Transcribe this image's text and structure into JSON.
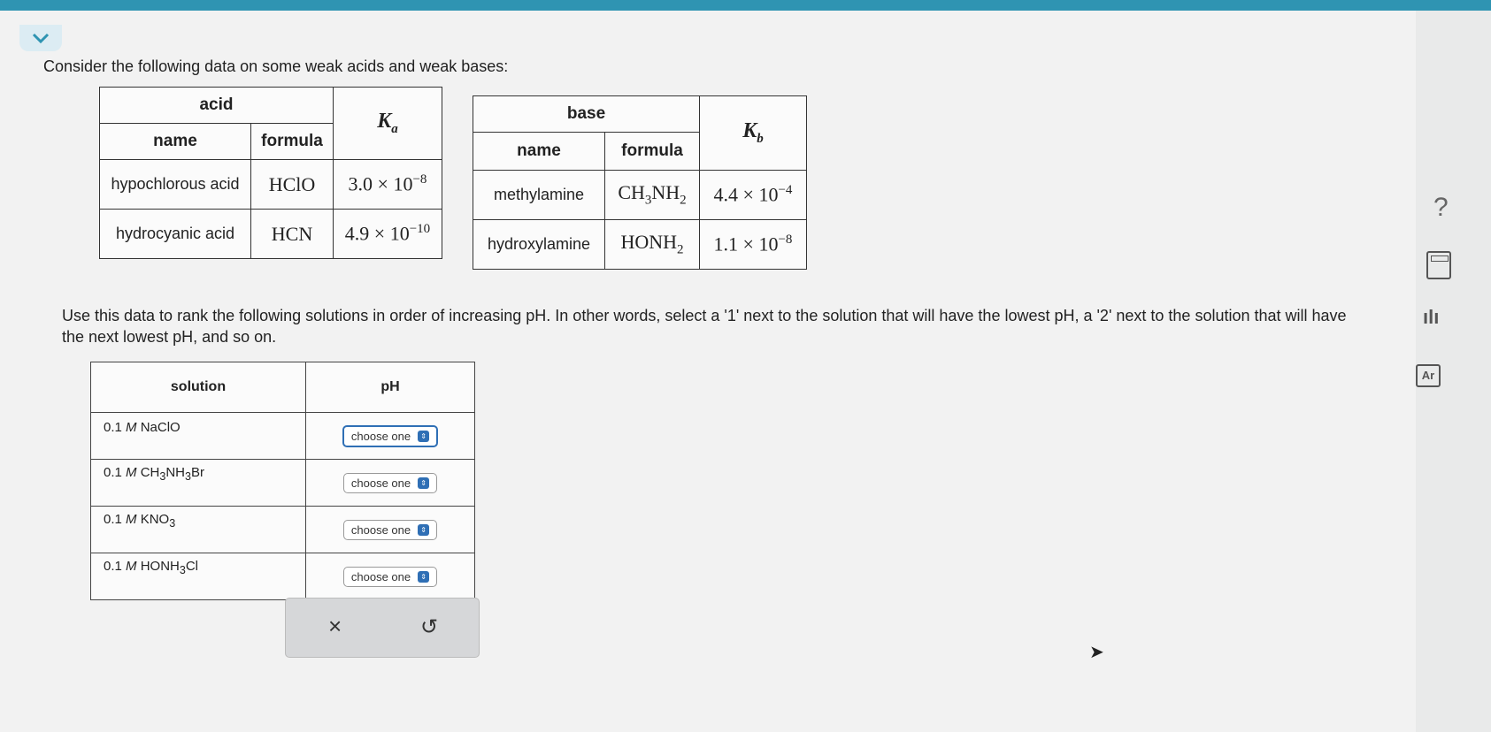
{
  "prompt": "Consider the following data on some weak acids and weak bases:",
  "acid_table": {
    "group_header": "acid",
    "col_name": "name",
    "col_formula": "formula",
    "k_symbol": "K",
    "k_sub": "a",
    "rows": [
      {
        "name": "hypochlorous acid",
        "formula": "HClO",
        "k_mant": "3.0 × 10",
        "k_exp": "−8"
      },
      {
        "name": "hydrocyanic acid",
        "formula": "HCN",
        "k_mant": "4.9 × 10",
        "k_exp": "−10"
      }
    ]
  },
  "base_table": {
    "group_header": "base",
    "col_name": "name",
    "col_formula": "formula",
    "k_symbol": "K",
    "k_sub": "b",
    "rows": [
      {
        "name": "methylamine",
        "formula_a": "CH",
        "sub1": "3",
        "formula_b": "NH",
        "sub2": "2",
        "k_mant": "4.4 × 10",
        "k_exp": "−4"
      },
      {
        "name": "hydroxylamine",
        "formula_a": "HONH",
        "sub1": "2",
        "k_mant": "1.1 × 10",
        "k_exp": "−8"
      }
    ]
  },
  "instructions": "Use this data to rank the following solutions in order of increasing pH. In other words, select a '1' next to the solution that will have the lowest pH, a '2' next to the solution that will have the next lowest pH, and so on.",
  "solution_table": {
    "col_solution": "solution",
    "col_ph": "pH",
    "rows": [
      {
        "conc": "0.1",
        "unit": "M",
        "f1": "NaClO",
        "s1": "",
        "f2": "",
        "s2": "",
        "f3": "",
        "select": "choose one"
      },
      {
        "conc": "0.1",
        "unit": "M",
        "f1": "CH",
        "s1": "3",
        "f2": "NH",
        "s2": "3",
        "f3": "Br",
        "select": "choose one"
      },
      {
        "conc": "0.1",
        "unit": "M",
        "f1": "KNO",
        "s1": "3",
        "f2": "",
        "s2": "",
        "f3": "",
        "select": "choose one"
      },
      {
        "conc": "0.1",
        "unit": "M",
        "f1": "HONH",
        "s1": "3",
        "f2": "Cl",
        "s2": "",
        "f3": "",
        "select": "choose one"
      }
    ]
  },
  "actions": {
    "clear_glyph": "×",
    "undo_glyph": "↺"
  },
  "side_tools": {
    "help_glyph": "?",
    "chart_glyph": "ılı",
    "ptable_glyph": "Ar"
  },
  "icons": [
    "chevron-down-icon",
    "question-icon",
    "calculator-icon",
    "bar-chart-icon",
    "periodic-table-icon",
    "clear-icon",
    "undo-icon"
  ],
  "colors": {
    "accent": "#2f94b2",
    "select_focus": "#2f6fb5"
  }
}
